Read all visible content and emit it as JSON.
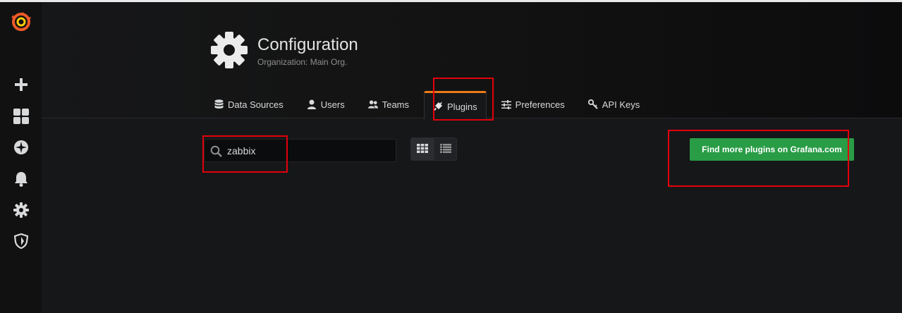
{
  "sidebar": {
    "items": [
      {
        "name": "grafana-logo",
        "icon": "grafana-logo-icon"
      },
      {
        "name": "create",
        "icon": "plus-icon"
      },
      {
        "name": "dashboards",
        "icon": "dashboards-grid-icon"
      },
      {
        "name": "explore",
        "icon": "compass-icon"
      },
      {
        "name": "alerting",
        "icon": "bell-icon"
      },
      {
        "name": "configuration",
        "icon": "gear-icon"
      },
      {
        "name": "server-admin",
        "icon": "shield-icon"
      }
    ]
  },
  "header": {
    "title": "Configuration",
    "subtitle": "Organization: Main Org."
  },
  "tabs": [
    {
      "label": "Data Sources",
      "icon": "database-icon",
      "active": false
    },
    {
      "label": "Users",
      "icon": "user-icon",
      "active": false
    },
    {
      "label": "Teams",
      "icon": "users-icon",
      "active": false
    },
    {
      "label": "Plugins",
      "icon": "plug-icon",
      "active": true
    },
    {
      "label": "Preferences",
      "icon": "sliders-icon",
      "active": false
    },
    {
      "label": "API Keys",
      "icon": "key-icon",
      "active": false
    }
  ],
  "search": {
    "value": "zabbix"
  },
  "view_toggle": {
    "selected": "grid",
    "options": [
      "grid",
      "list"
    ]
  },
  "actions": {
    "find_more_label": "Find more plugins on Grafana.com"
  },
  "colors": {
    "accent": "#eb7b18",
    "primary_button": "#299c46",
    "highlight": "#e3000b",
    "background": "#161719"
  }
}
